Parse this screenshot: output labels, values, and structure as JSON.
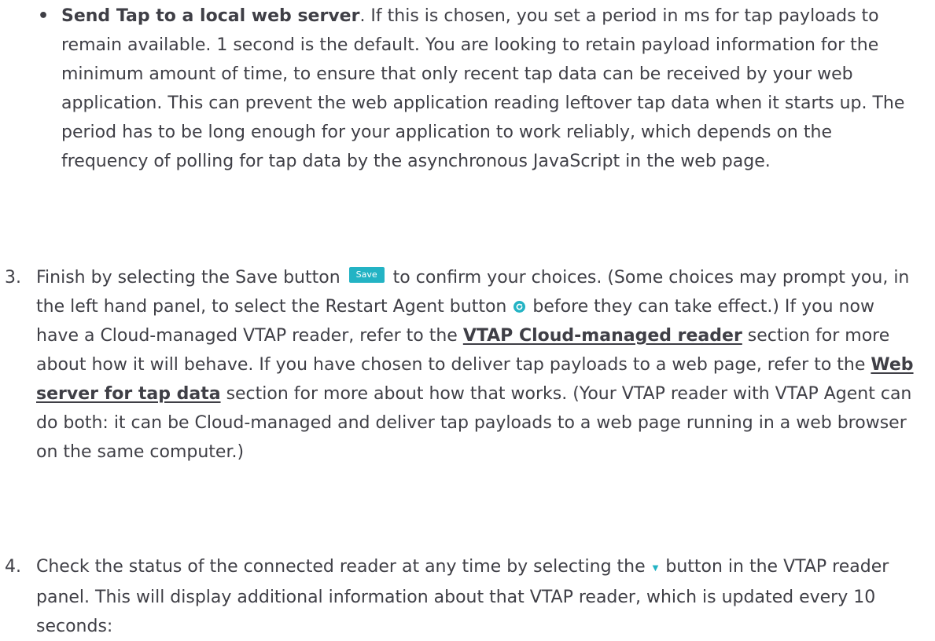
{
  "bullet": {
    "marker": "•",
    "title": "Send Tap to a local web server",
    "text": ". If this is chosen, you set a period in ms for tap payloads to remain available. 1 second is the default. You are looking to retain payload information for the minimum amount of time, to ensure that only recent tap data can be received by your web application. This can prevent the web application reading leftover tap data when it starts up. The period has to be long enough for your application to work reliably, which depends on the frequency of polling for tap data by the asynchronous JavaScript in the web page."
  },
  "step3": {
    "number": "3.",
    "text_1": "Finish by selecting the Save button",
    "save_button_label": "Save",
    "text_2": "to confirm your choices. (Some choices may prompt you, in the left hand panel, to select the Restart Agent button",
    "text_3": "before they can take effect.) If you now have a Cloud-managed VTAP reader, refer to the",
    "link_1": "VTAP Cloud-managed reader",
    "text_4": "section for more about how it will behave. If you have chosen to deliver tap payloads to a web page, refer to the",
    "link_2": "Web server for tap data",
    "text_5": "section for more about how that works. (Your VTAP reader with VTAP Agent can do both: it can be Cloud-managed and deliver tap payloads to a web page running in a web browser on the same computer.)"
  },
  "step4": {
    "number": "4.",
    "text_1": "Check the status of the connected reader at any time by selecting the",
    "text_2": "button in the VTAP reader panel. This will display additional information about that VTAP reader, which is updated every 10 seconds:"
  },
  "icons": {
    "restart": "restart-agent-icon",
    "caret": "caret-down-icon"
  },
  "colors": {
    "accent": "#23b3c4",
    "text": "#3f3f46"
  }
}
